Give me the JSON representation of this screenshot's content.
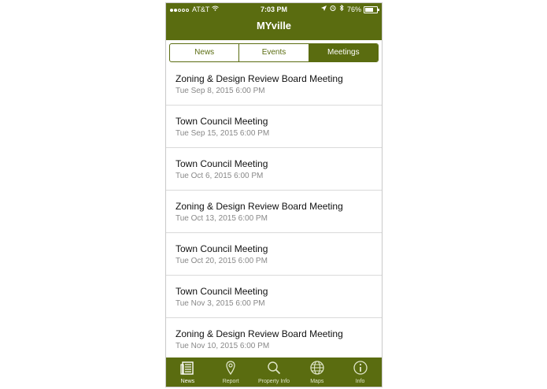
{
  "status_bar": {
    "carrier": "AT&T",
    "time": "7:03 PM",
    "battery": "76%"
  },
  "app": {
    "title": "MYville"
  },
  "segments": [
    {
      "label": "News",
      "active": false
    },
    {
      "label": "Events",
      "active": false
    },
    {
      "label": "Meetings",
      "active": true
    }
  ],
  "meetings": [
    {
      "title": "Zoning & Design Review Board Meeting",
      "date": "Tue Sep 8, 2015 6:00 PM"
    },
    {
      "title": "Town Council Meeting",
      "date": "Tue Sep 15, 2015 6:00 PM"
    },
    {
      "title": "Town Council Meeting",
      "date": "Tue Oct 6, 2015 6:00 PM"
    },
    {
      "title": "Zoning & Design Review Board Meeting",
      "date": "Tue Oct 13, 2015 6:00 PM"
    },
    {
      "title": "Town Council Meeting",
      "date": "Tue Oct 20, 2015 6:00 PM"
    },
    {
      "title": "Town Council Meeting",
      "date": "Tue Nov 3, 2015 6:00 PM"
    },
    {
      "title": "Zoning & Design Review Board Meeting",
      "date": "Tue Nov 10, 2015 6:00 PM"
    }
  ],
  "tabbar": [
    {
      "label": "News",
      "icon": "news-icon",
      "active": true
    },
    {
      "label": "Report",
      "icon": "map-pin-icon",
      "active": false
    },
    {
      "label": "Property Info",
      "icon": "search-icon",
      "active": false
    },
    {
      "label": "Maps",
      "icon": "globe-icon",
      "active": false
    },
    {
      "label": "Info",
      "icon": "info-icon",
      "active": false
    }
  ],
  "colors": {
    "brand": "#5a6c10"
  }
}
